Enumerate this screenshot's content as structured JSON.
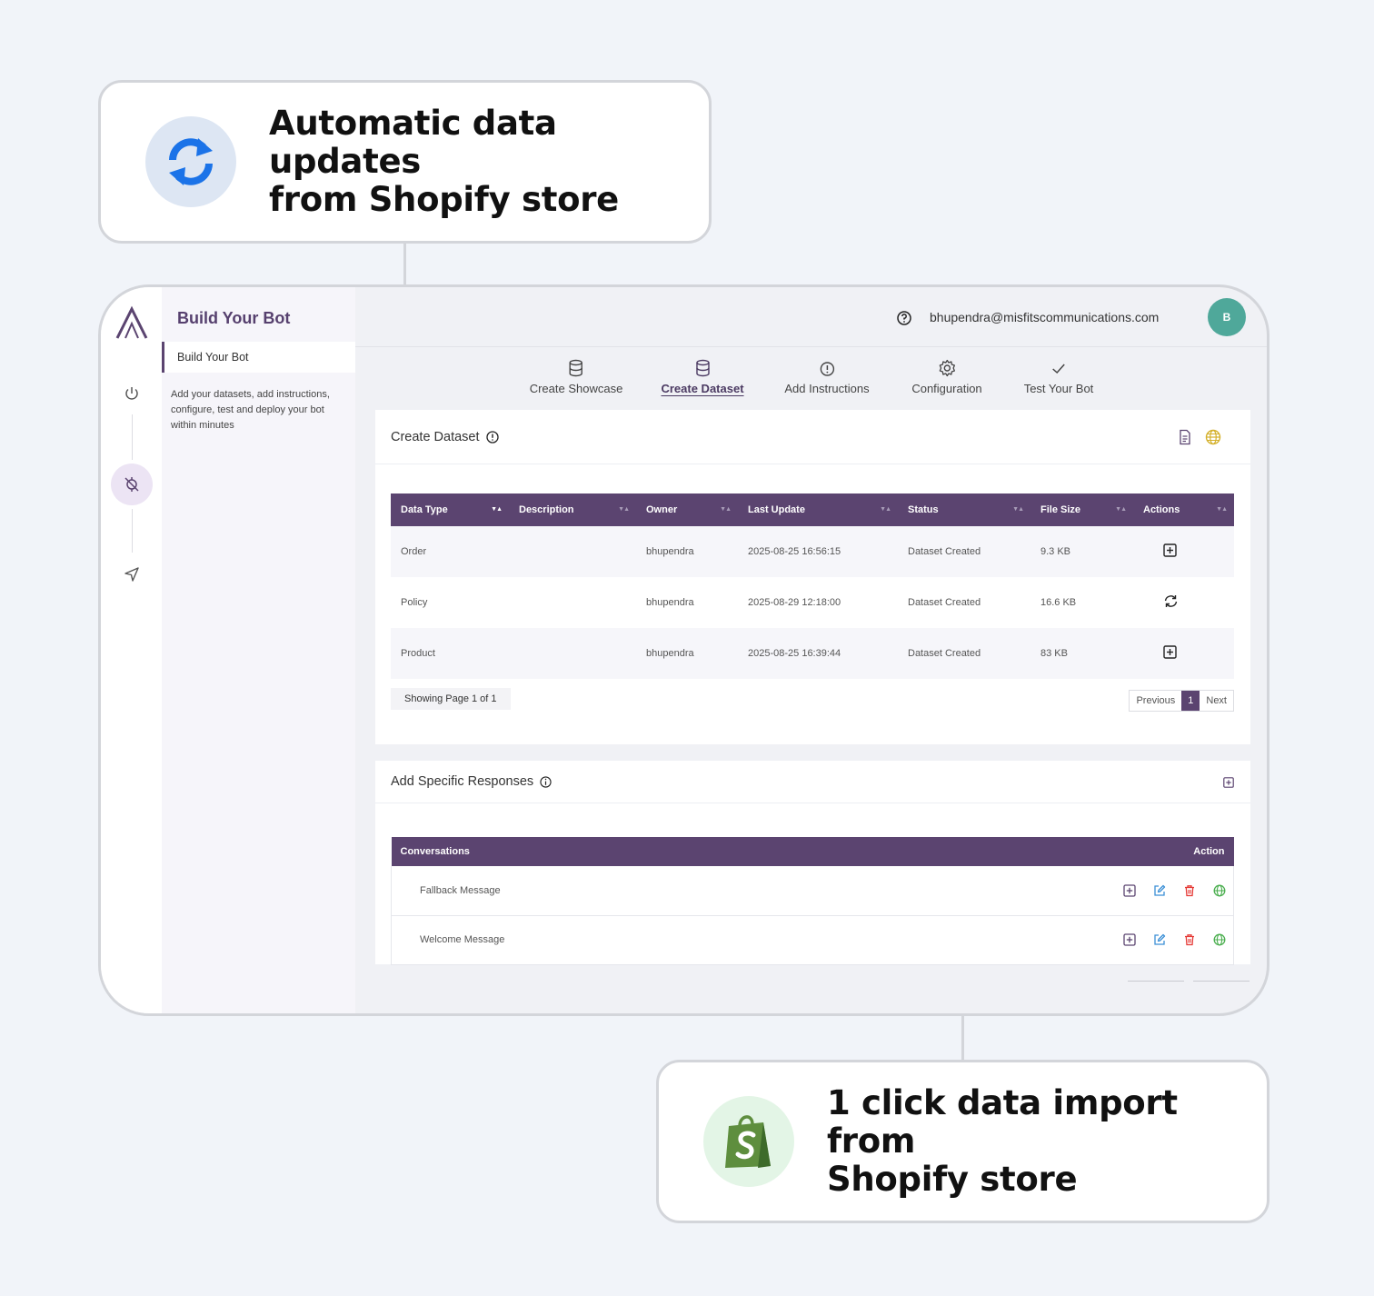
{
  "callouts": {
    "top": {
      "line1": "Automatic data updates",
      "line2": "from Shopify store",
      "icon": "sync-icon"
    },
    "bottom": {
      "line1": "1 click data import from",
      "line2": "Shopify store",
      "icon": "shopify-bag-icon"
    }
  },
  "sidebar": {
    "title": "Build Your Bot",
    "active_item": "Build Your Bot",
    "description": "Add your datasets, add instructions, configure, test and deploy your bot within minutes"
  },
  "header": {
    "email": "bhupendra@misfitscommunications.com",
    "avatar_initial": "B"
  },
  "steps": [
    {
      "label": "Create Showcase",
      "icon": "database-icon"
    },
    {
      "label": "Create Dataset",
      "icon": "database-icon",
      "active": true
    },
    {
      "label": "Add Instructions",
      "icon": "alert-circle-icon"
    },
    {
      "label": "Configuration",
      "icon": "gear-icon"
    },
    {
      "label": "Test Your Bot",
      "icon": "check-icon"
    }
  ],
  "dataset": {
    "title": "Create Dataset",
    "columns": [
      "Data Type",
      "Description",
      "Owner",
      "Last Update",
      "Status",
      "File Size",
      "Actions"
    ],
    "rows": [
      {
        "type": "Order",
        "description": "",
        "owner": "bhupendra",
        "updated": "2025-08-25 16:56:15",
        "status": "Dataset Created",
        "size": "9.3 KB",
        "action": "plus-square-icon"
      },
      {
        "type": "Policy",
        "description": "",
        "owner": "bhupendra",
        "updated": "2025-08-29 12:18:00",
        "status": "Dataset Created",
        "size": "16.6 KB",
        "action": "sync-icon"
      },
      {
        "type": "Product",
        "description": "",
        "owner": "bhupendra",
        "updated": "2025-08-25 16:39:44",
        "status": "Dataset Created",
        "size": "83 KB",
        "action": "plus-square-icon"
      }
    ],
    "page_info": "Showing Page 1 of 1",
    "pager": {
      "prev": "Previous",
      "current": "1",
      "next": "Next"
    }
  },
  "responses": {
    "title": "Add Specific Responses",
    "col_conversations": "Conversations",
    "col_action": "Action",
    "rows": [
      {
        "name": "Fallback Message"
      },
      {
        "name": "Welcome Message"
      }
    ]
  },
  "colors": {
    "primary": "#5b4470",
    "accent_green": "#4caf50",
    "accent_blue": "#1b73e8",
    "danger": "#e53935",
    "avatar": "#4fa89a"
  }
}
